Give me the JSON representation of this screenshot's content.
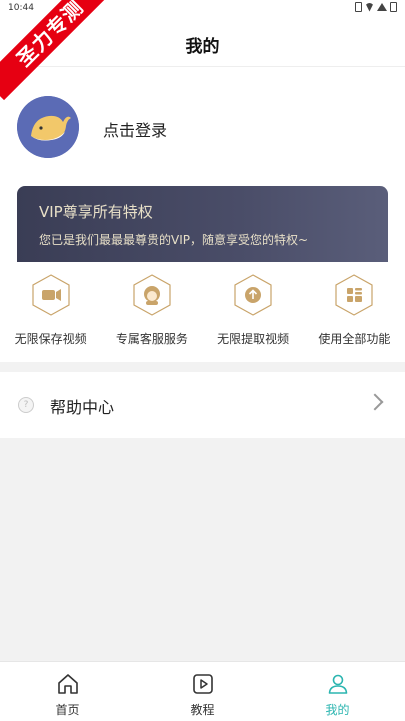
{
  "status_bar": {
    "time": "10:44"
  },
  "watermark": "圣力专测",
  "header": {
    "title": "我的"
  },
  "profile": {
    "login_text": "点击登录"
  },
  "vip": {
    "title": "VIP尊享所有特权",
    "subtitle": "您已是我们最最最尊贵的VIP，随意享受您的特权~"
  },
  "features": [
    {
      "label": "无限保存视频",
      "icon": "video-camera-icon"
    },
    {
      "label": "专属客服服务",
      "icon": "customer-service-icon"
    },
    {
      "label": "无限提取视频",
      "icon": "upload-icon"
    },
    {
      "label": "使用全部功能",
      "icon": "grid-apps-icon"
    }
  ],
  "help": {
    "label": "帮助中心"
  },
  "tabs": [
    {
      "label": "首页",
      "icon": "home-icon"
    },
    {
      "label": "教程",
      "icon": "play-icon"
    },
    {
      "label": "我的",
      "icon": "person-icon",
      "active": true
    }
  ],
  "colors": {
    "accent": "#2bb5b0",
    "vip_gold": "#c9a46a",
    "watermark_red": "#e60012",
    "avatar_bg": "#5b6bb5"
  }
}
